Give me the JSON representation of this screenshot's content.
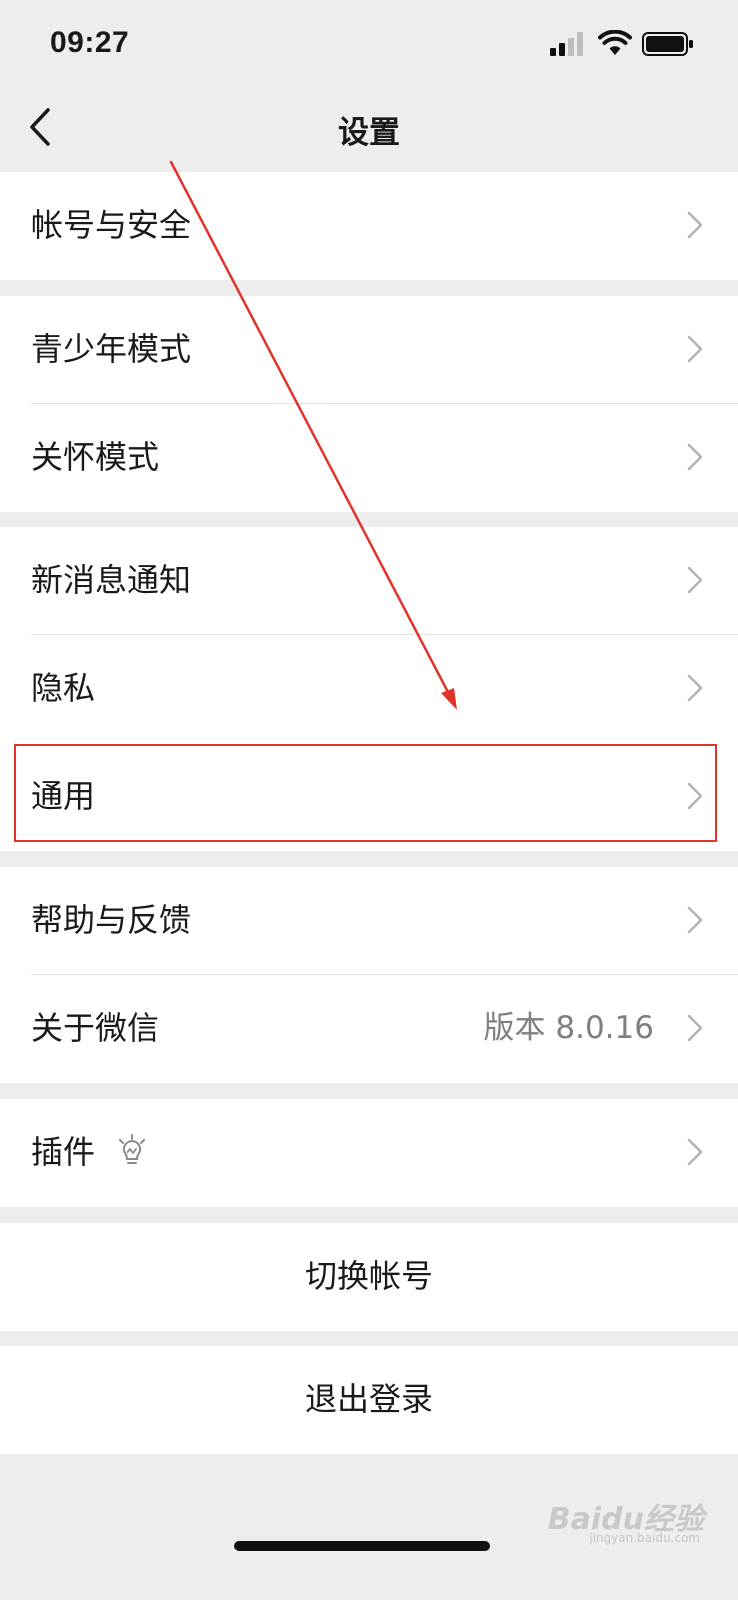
{
  "status_bar": {
    "time": "09:27"
  },
  "header": {
    "title": "设置",
    "back_icon": "chevron-left-icon"
  },
  "groups": [
    {
      "items": [
        {
          "label": "帐号与安全"
        }
      ]
    },
    {
      "items": [
        {
          "label": "青少年模式"
        },
        {
          "label": "关怀模式"
        }
      ]
    },
    {
      "items": [
        {
          "label": "新消息通知"
        },
        {
          "label": "隐私"
        },
        {
          "label": "通用"
        }
      ]
    },
    {
      "items": [
        {
          "label": "帮助与反馈"
        },
        {
          "label": "关于微信",
          "value": "版本 8.0.16"
        }
      ]
    },
    {
      "items": [
        {
          "label": "插件",
          "icon": "lightbulb-icon"
        }
      ]
    }
  ],
  "actions": {
    "switch_account": "切换帐号",
    "logout": "退出登录"
  },
  "annotation": {
    "highlight_color": "#e0342a"
  },
  "watermark": {
    "text": "Baidu经验",
    "sub": "jingyan.baidu.com"
  }
}
